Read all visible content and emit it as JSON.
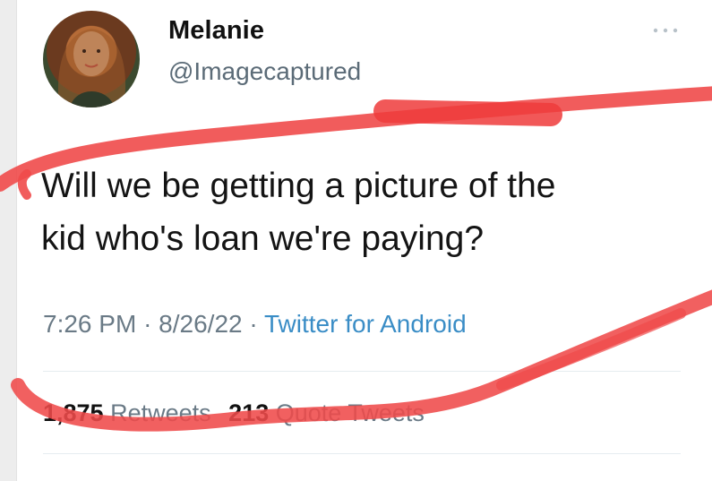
{
  "tweet": {
    "author": {
      "display_name": "Melanie",
      "handle": "@Imagecaptured"
    },
    "more_label": "···",
    "text_lines": [
      "Will we be getting a picture of the",
      "kid who's loan we're paying?"
    ],
    "meta": {
      "time": "7:26 PM",
      "separator": "·",
      "date": "8/26/22",
      "source": "Twitter for Android"
    },
    "stats": {
      "retweets_count": "1,875",
      "retweets_label": "Retweets",
      "quotes_count": "213",
      "quotes_label": "Quote Tweets"
    }
  },
  "colors": {
    "annotation_red": "#ef4a4a",
    "source_blue": "#3a8dc6",
    "muted_text": "#6a7a86"
  }
}
